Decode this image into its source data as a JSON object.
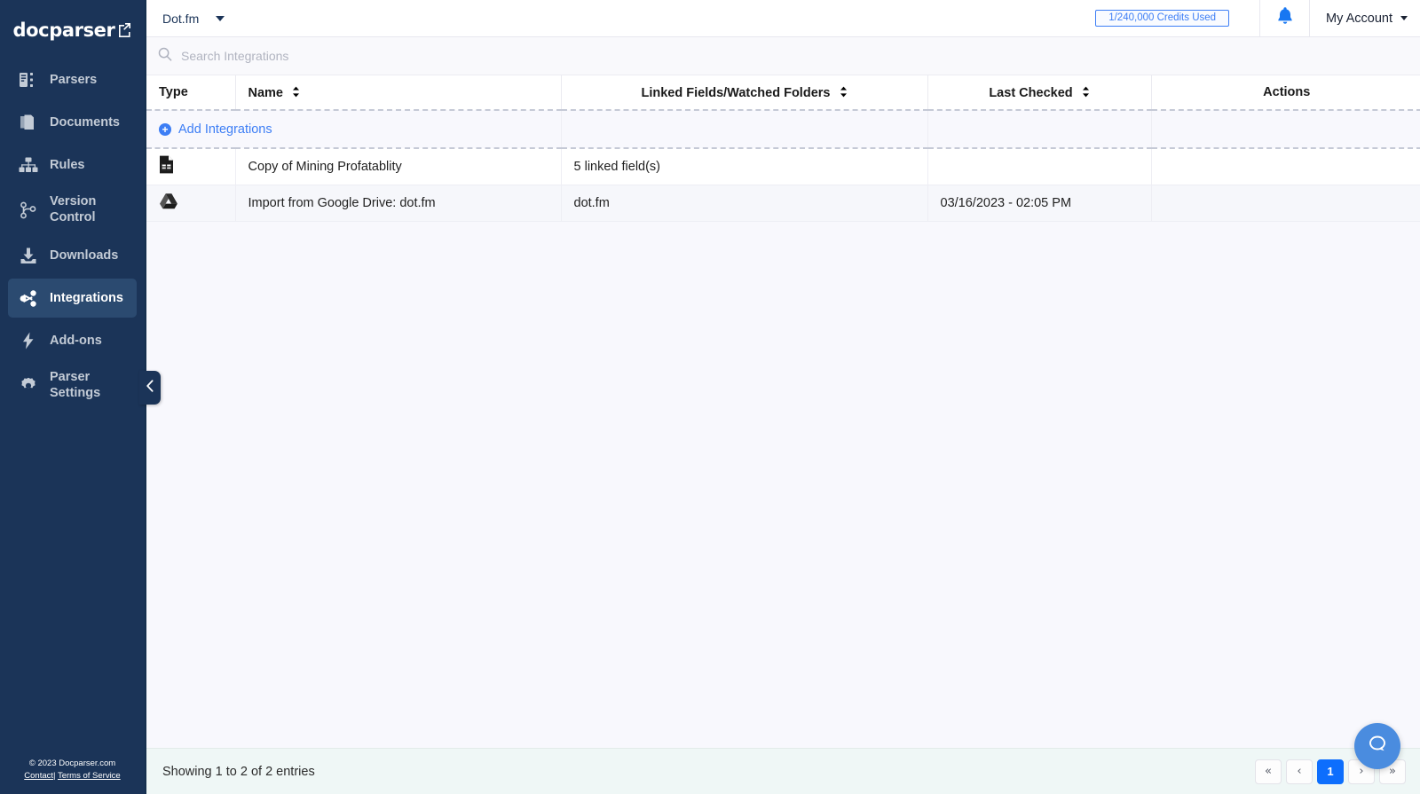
{
  "brand": {
    "name": "docparser",
    "mark_icon": "external-link-icon"
  },
  "sidebar": {
    "items": [
      {
        "label": "Parsers",
        "icon": "parsers-icon",
        "active": false
      },
      {
        "label": "Documents",
        "icon": "documents-icon",
        "active": false
      },
      {
        "label": "Rules",
        "icon": "rules-icon",
        "active": false
      },
      {
        "label": "Version Control",
        "icon": "version-control-icon",
        "active": false
      },
      {
        "label": "Downloads",
        "icon": "download-icon",
        "active": false
      },
      {
        "label": "Integrations",
        "icon": "share-icon",
        "active": true
      },
      {
        "label": "Add-ons",
        "icon": "bolt-icon",
        "active": false
      },
      {
        "label": "Parser Settings",
        "icon": "gear-icon",
        "active": false
      }
    ],
    "footer": {
      "copyright": "© 2023 Docparser.com",
      "contact_label": "Contact",
      "separator": "|",
      "terms_label": "Terms of Service"
    },
    "collapse_icon": "chevron-left-icon"
  },
  "topbar": {
    "account_selector": "Dot.fm",
    "credits_badge": "1/240,000 Credits Used",
    "notifications_icon": "bell-icon",
    "my_account_label": "My Account"
  },
  "search": {
    "placeholder": "Search Integrations",
    "value": "",
    "icon": "search-icon"
  },
  "table": {
    "columns": [
      {
        "label": "Type",
        "sortable": false,
        "align": "left"
      },
      {
        "label": "Name",
        "sortable": true,
        "align": "left"
      },
      {
        "label": "Linked Fields/Watched Folders",
        "sortable": true,
        "align": "center"
      },
      {
        "label": "Last Checked",
        "sortable": true,
        "align": "center"
      },
      {
        "label": "Actions",
        "sortable": false,
        "align": "center"
      }
    ],
    "add_row": {
      "label": "Add Integrations",
      "icon": "plus-circle-icon"
    },
    "rows": [
      {
        "type_icon": "google-sheets-icon",
        "name": "Copy of Mining Profatablity",
        "linked": "5 linked field(s)",
        "last_checked": "",
        "actions": ""
      },
      {
        "type_icon": "google-drive-icon",
        "name": "Import from Google Drive: dot.fm",
        "linked": "dot.fm",
        "last_checked": "03/16/2023 - 02:05 PM",
        "actions": ""
      }
    ]
  },
  "footer": {
    "entries_text": "Showing 1 to 2 of 2 entries",
    "pagination": [
      {
        "label": "«",
        "name": "first",
        "active": false
      },
      {
        "label": "‹",
        "name": "prev",
        "active": false
      },
      {
        "label": "1",
        "name": "page-1",
        "active": true
      },
      {
        "label": "›",
        "name": "next",
        "active": false
      },
      {
        "label": "»",
        "name": "last",
        "active": false
      }
    ]
  },
  "chat": {
    "icon": "chat-bubble-icon"
  },
  "colors": {
    "sidebar_bg": "#1b3458",
    "sidebar_active_bg": "#2b4a70",
    "accent_blue": "#3d7ef5",
    "pager_active": "#0d6efd",
    "main_bg": "#f8f8fd",
    "footer_bg": "#eff7f6",
    "chat_fab": "#4a8cdf"
  }
}
